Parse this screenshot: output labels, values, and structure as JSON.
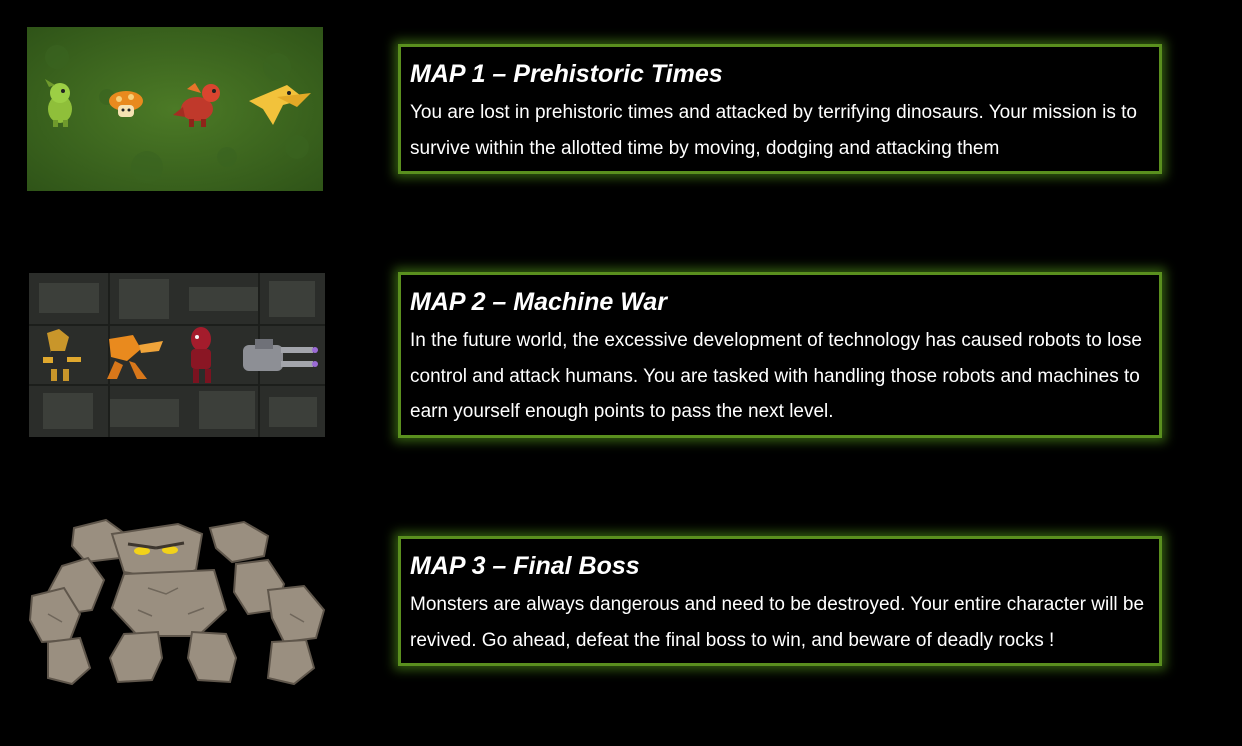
{
  "maps": [
    {
      "title": "MAP 1 – Prehistoric Times",
      "description": "You are lost in prehistoric times and attacked by terrifying dinosaurs. Your mission is to survive within the allotted time by moving, dodging and attacking them",
      "image": "prehistoric-dinosaurs-on-grass"
    },
    {
      "title": "MAP 2 – Machine War",
      "description": "In the future world, the excessive development of technology has caused robots to lose control and attack humans. You are tasked with handling those robots and machines to earn yourself enough points to pass the next level.",
      "image": "robots-and-turret-on-city-map"
    },
    {
      "title": "MAP 3 – Final Boss",
      "description": "Monsters are always dangerous and need to be destroyed. Your entire character will be revived. Go ahead, defeat the final boss to win, and beware of deadly rocks !",
      "image": "rock-golem-boss"
    }
  ],
  "colors": {
    "background": "#000000",
    "card_border": "#5a8f1e",
    "card_glow": "#6aa82a",
    "text": "#ffffff"
  }
}
